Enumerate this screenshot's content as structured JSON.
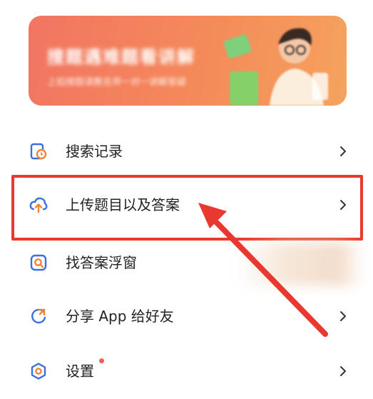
{
  "banner": {
    "title": "搜题遇难题看讲解",
    "subtitle": "上拍搜题请教名师一对一讲解答疑"
  },
  "menu": [
    {
      "label": "搜索记录",
      "icon": "history-icon"
    },
    {
      "label": "上传题目以及答案",
      "icon": "upload-cloud-icon"
    },
    {
      "label": "找答案浮窗",
      "icon": "float-window-search-icon"
    },
    {
      "label": "分享 App 给好友",
      "icon": "share-icon"
    },
    {
      "label": "设置",
      "icon": "settings-icon",
      "has_dot": true
    }
  ],
  "colors": {
    "accent_blue": "#3b6fe0",
    "accent_orange": "#f0843c",
    "highlight_red": "#e8382f"
  }
}
